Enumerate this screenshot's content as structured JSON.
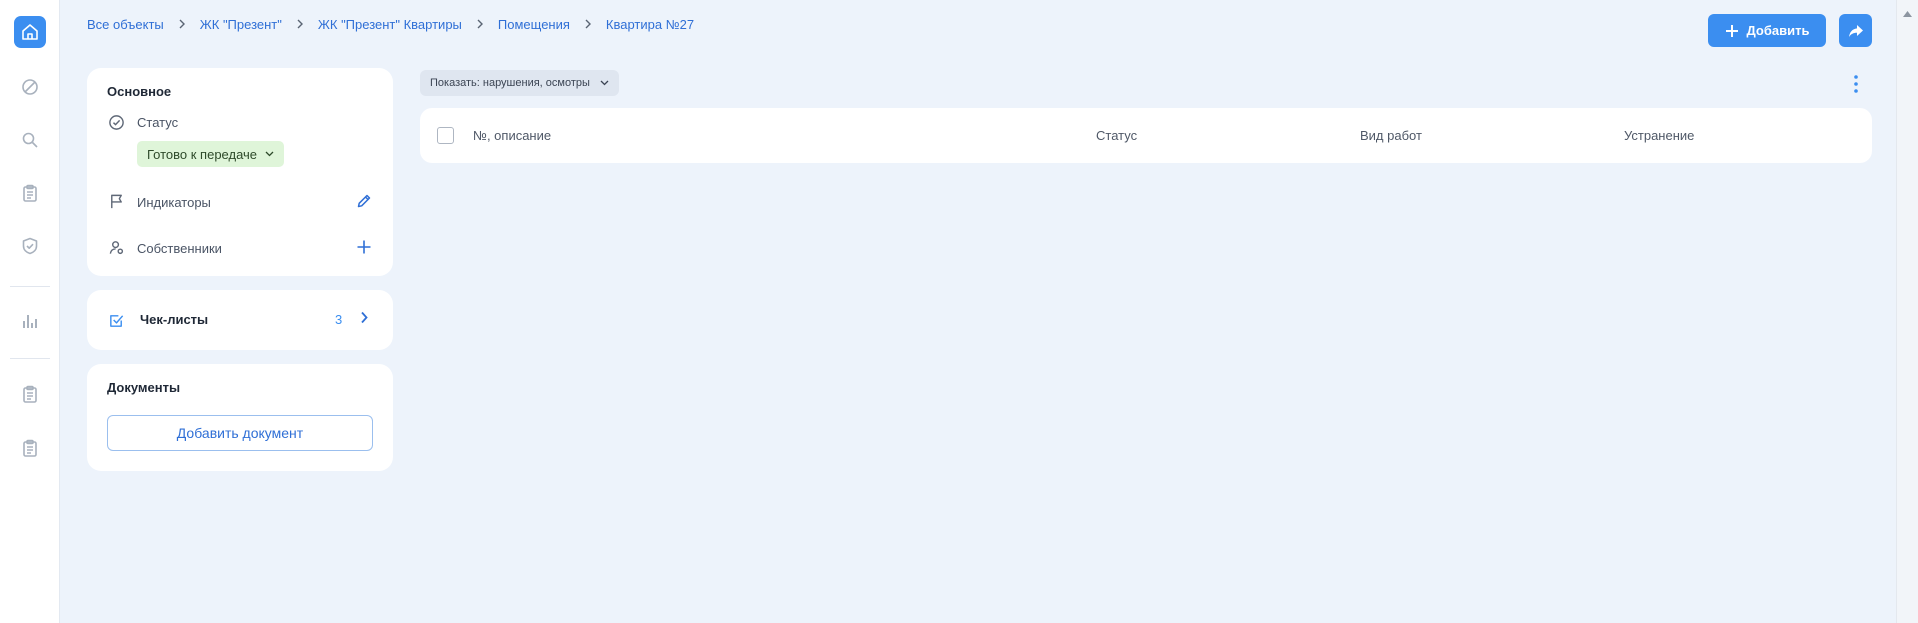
{
  "breadcrumb": {
    "items": [
      "Все объекты",
      "ЖК \"Презент\"",
      "ЖК \"Презент\" Квартиры",
      "Помещения",
      "Квартира №27"
    ]
  },
  "header": {
    "add_label": "Добавить"
  },
  "main_card": {
    "title": "Основное",
    "status_label": "Статус",
    "status_value": "Готово к передаче",
    "indicators_label": "Индикаторы",
    "owners_label": "Собственники"
  },
  "checklists": {
    "label": "Чек-листы",
    "count": "3"
  },
  "documents": {
    "title": "Документы",
    "add_label": "Добавить документ"
  },
  "filter": {
    "label": "Показать: нарушения, осмотры"
  },
  "table": {
    "columns": [
      "№, описание",
      "Статус",
      "Вид работ",
      "Устранение"
    ]
  },
  "colors": {
    "accent": "#3b8ef0",
    "background": "#edf3fb",
    "status_bg": "#dff5d9"
  }
}
